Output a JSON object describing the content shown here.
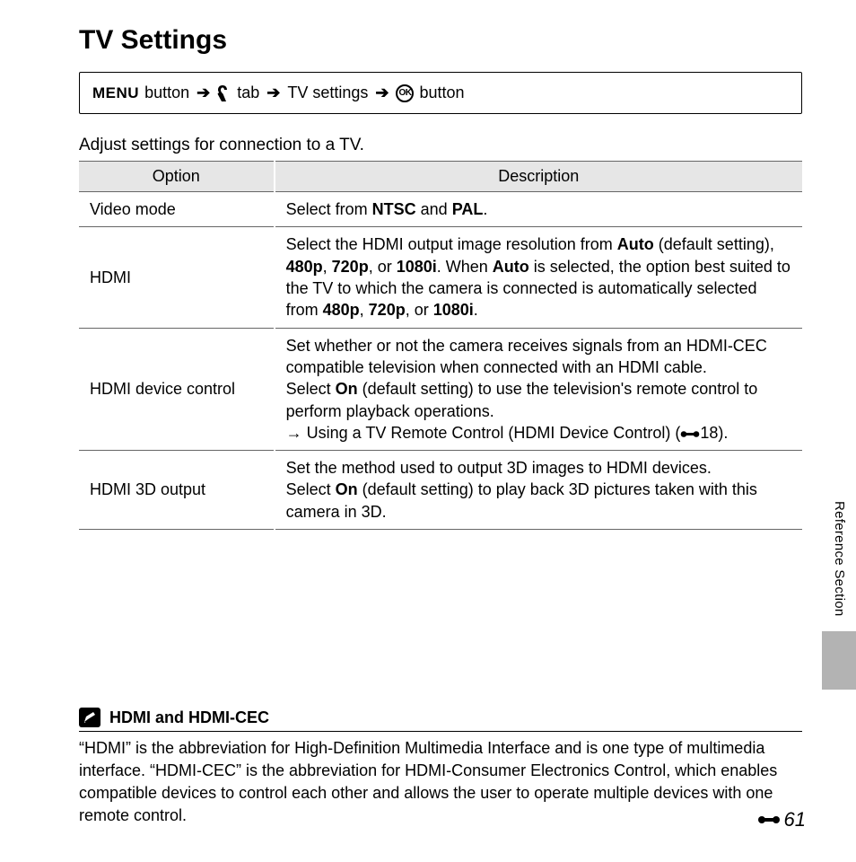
{
  "heading": "TV Settings",
  "nav": {
    "menu": "MENU",
    "btn1": "button",
    "tab": "tab",
    "tv_settings": "TV settings",
    "btn2": "button",
    "ok": "OK"
  },
  "intro": "Adjust settings for connection to a TV.",
  "table": {
    "headers": {
      "option": "Option",
      "description": "Description"
    },
    "rows": {
      "video_mode": {
        "opt": "Video mode",
        "d1": "Select from ",
        "d2": "NTSC",
        "d3": " and ",
        "d4": "PAL",
        "d5": "."
      },
      "hdmi": {
        "opt": "HDMI",
        "p1": "Select the HDMI output image resolution from ",
        "p2": "Auto",
        "p3": " (default setting), ",
        "p4": "480p",
        "p5": ", ",
        "p6": "720p",
        "p7": ", or ",
        "p8": "1080i",
        "p9": ". When ",
        "p10": "Auto",
        "p11": " is selected, the option best suited to the TV to which the camera is connected is automatically selected from ",
        "p12": "480p",
        "p13": ", ",
        "p14": "720p",
        "p15": ", or ",
        "p16": "1080i",
        "p17": "."
      },
      "hdmi_dc": {
        "opt": "HDMI device control",
        "l1": "Set whether or not the camera receives signals from an HDMI-CEC compatible television when connected with an HDMI cable.",
        "l2a": "Select ",
        "l2b": "On",
        "l2c": " (default setting) to use the television's remote control to perform playback operations.",
        "l3a": "→ Using a TV Remote Control (HDMI Device Control) (",
        "l3b": "18)."
      },
      "hdmi_3d": {
        "opt": "HDMI 3D output",
        "l1": "Set the method used to output 3D images to HDMI devices.",
        "l2a": "Select ",
        "l2b": "On",
        "l2c": " (default setting) to play back 3D pictures taken with this camera in 3D."
      }
    }
  },
  "side_label": "Reference Section",
  "note": {
    "title": "HDMI and HDMI-CEC",
    "body": "“HDMI” is the abbreviation for High-Definition Multimedia Interface and is one type of multimedia interface. “HDMI-CEC” is the abbreviation for HDMI-Consumer Electronics Control, which enables compatible devices to control each other and allows the user to operate multiple devices with one remote control."
  },
  "page_number": "61"
}
